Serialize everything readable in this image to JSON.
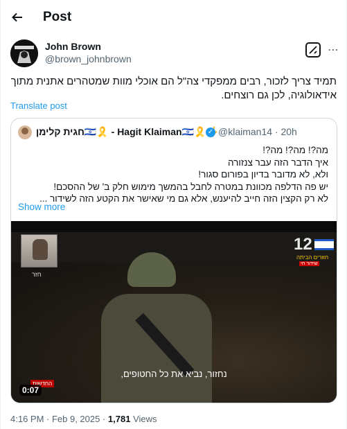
{
  "header": {
    "title": "Post",
    "back_icon": "arrow-left-icon"
  },
  "author": {
    "name": "John Brown",
    "handle": "@brown_johnbrown",
    "grok_icon": "grok-icon",
    "more_icon": "more-icon"
  },
  "post": {
    "text_line1": "תמיד צריך לזכור, רבים ממפקדי צה\"ל הם אוכלי מוות שמטהרים אתנית מתוך",
    "text_line2": "אידאולוגיה, לכן גם רוצחים.",
    "translate_label": "Translate post"
  },
  "quoted": {
    "name": "חגית קלימן🇮🇱🎗️ - Hagit Klaiman🇮🇱🎗️🤟",
    "handle": "@klaiman14",
    "time": "· 20h",
    "lines": [
      "מה?! מה?! מה?!",
      "איך הדבר הזה עבר צנזורה",
      "ולא, לא מדובר בדיון בפורום סגור!",
      "יש פה הדלפה מכוונת במטרה לחבל בהמשך מימוש חלק ב' של ההסכם!",
      "לא רק הקצין הזה חייב להיענש, אלא גם מי שאישר את הקטע הזה לשידור ..."
    ],
    "show_more": "Show more",
    "video": {
      "subtitle": "נחזור, נביא את כל החטופים,",
      "channel": "12",
      "channel_line1": "חוזרים הביתה",
      "channel_line2": "שידור חי",
      "pip_label": "חזר",
      "news_tag": "החדשות",
      "duration": "0:07"
    }
  },
  "meta": {
    "time": "4:16 PM · Feb 9, 2025 · ",
    "views": "1,781",
    "views_label": " Views"
  }
}
